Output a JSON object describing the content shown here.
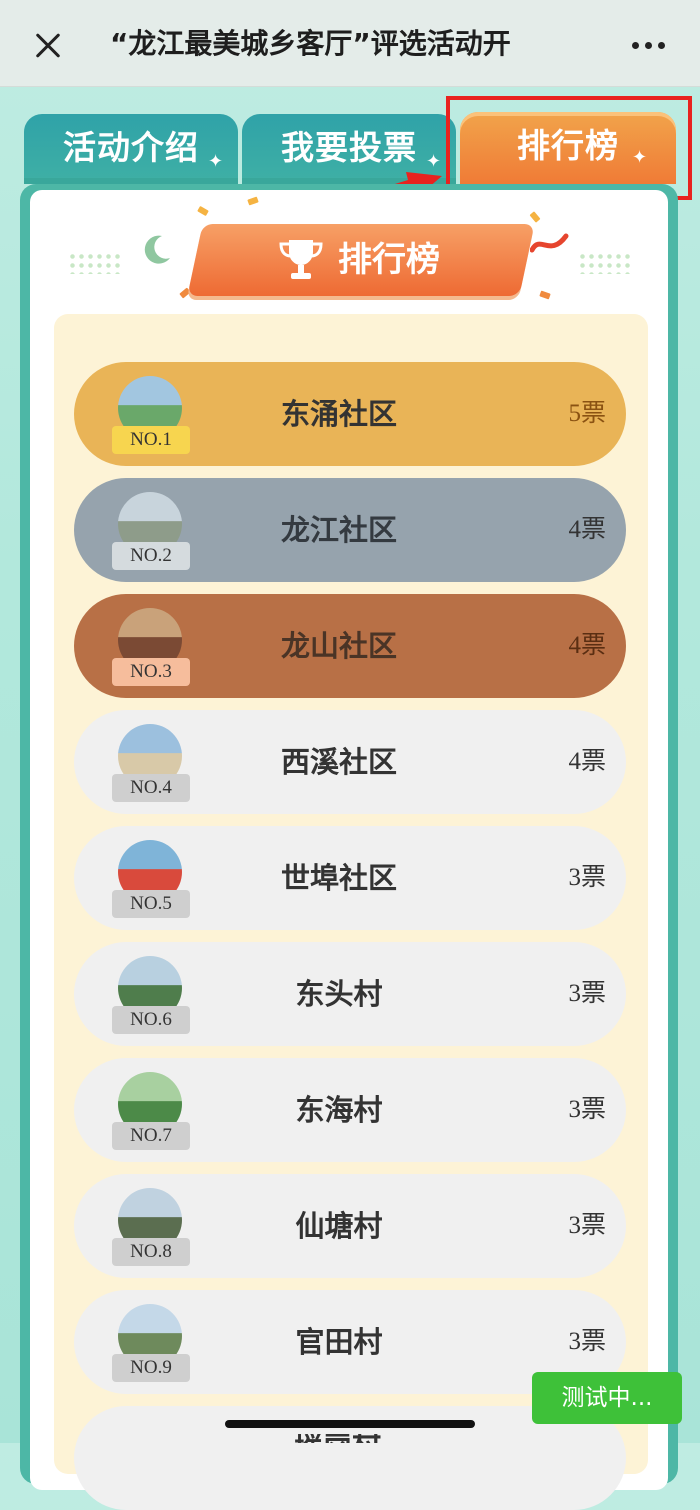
{
  "topbar": {
    "title": "“龙江最美城乡客厅”评选活动开",
    "close_icon": "close-icon",
    "more_icon": "more-dots-icon"
  },
  "tabs": [
    {
      "label": "活动介绍",
      "active": false
    },
    {
      "label": "我要投票",
      "active": false
    },
    {
      "label": "排行榜",
      "active": true
    }
  ],
  "banner": {
    "title": "排行榜",
    "icon": "trophy-icon"
  },
  "ranking": [
    {
      "rank": "NO.1",
      "name": "东涌社区",
      "votes": "5票"
    },
    {
      "rank": "NO.2",
      "name": "龙江社区",
      "votes": "4票"
    },
    {
      "rank": "NO.3",
      "name": "龙山社区",
      "votes": "4票"
    },
    {
      "rank": "NO.4",
      "name": "西溪社区",
      "votes": "4票"
    },
    {
      "rank": "NO.5",
      "name": "世埠社区",
      "votes": "3票"
    },
    {
      "rank": "NO.6",
      "name": "东头村",
      "votes": "3票"
    },
    {
      "rank": "NO.7",
      "name": "东海村",
      "votes": "3票"
    },
    {
      "rank": "NO.8",
      "name": "仙塘村",
      "votes": "3票"
    },
    {
      "rank": "NO.9",
      "name": "官田村",
      "votes": "3票"
    }
  ],
  "test_button": "测试中...",
  "colors": {
    "rank1": "#e9b457",
    "rank2": "#96a3ad",
    "rank3": "#b87046",
    "tab_active": "#f07b36",
    "tab_inactive": "#3fb0a5",
    "annotation": "#e8231f"
  }
}
